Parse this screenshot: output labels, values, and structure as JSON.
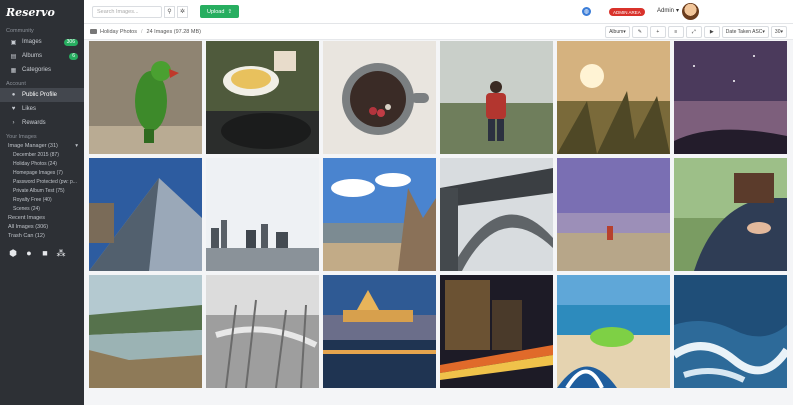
{
  "app": {
    "logo_text": "Reservo"
  },
  "sidebar": {
    "community_title": "Community",
    "community_items": [
      {
        "label": "Images",
        "badge": "306"
      },
      {
        "label": "Albums",
        "badge": "6"
      },
      {
        "label": "Categories",
        "badge": ""
      }
    ],
    "account_title": "Account",
    "account_items": [
      {
        "label": "Public Profile"
      },
      {
        "label": "Likes"
      },
      {
        "label": "Rewards"
      }
    ],
    "your_images_title": "Your Images",
    "image_manager": "Image Manager (31)",
    "folders": [
      "December 2015 (87)",
      "Holiday Photos (24)",
      "Homepage Images (7)",
      "Password Protected (pw: p...",
      "Private Album Test (75)",
      "Royalty Free (40)",
      "Scenes (24)"
    ],
    "recent_images": "Recent Images",
    "all_images": "All Images (306)",
    "trash_can": "Trash Can (12)"
  },
  "topbar": {
    "search_placeholder": "Search Images...",
    "upload_label": "Upload",
    "admin_badge": "ADMIN AREA",
    "user_name": "Admin"
  },
  "toolbar": {
    "breadcrumb_album": "Holiday Photos",
    "breadcrumb_info": "24 Images (97.28 MB)",
    "view_select": "Album",
    "sort_select": "Date Taken ASC",
    "per_page": "30"
  },
  "colors": {
    "accent_green": "#27ae60",
    "admin_red": "#d9322b",
    "sidebar_bg": "#2d3035"
  }
}
